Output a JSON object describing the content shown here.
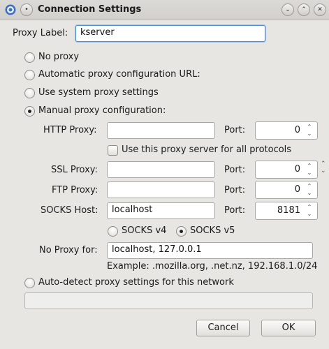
{
  "window": {
    "title": "Connection Settings"
  },
  "proxy_label": {
    "label": "Proxy Label:",
    "value": "kserver"
  },
  "options": {
    "no_proxy": "No proxy",
    "auto_url": "Automatic proxy configuration URL:",
    "system": "Use system proxy settings",
    "manual": "Manual proxy configuration:",
    "auto_detect": "Auto-detect proxy settings for this network"
  },
  "http": {
    "label": "HTTP Proxy:",
    "value": "",
    "port_label": "Port:",
    "port": "0"
  },
  "use_all": "Use this proxy server for all protocols",
  "ssl": {
    "label": "SSL Proxy:",
    "value": "",
    "port_label": "Port:",
    "port": "0"
  },
  "ftp": {
    "label": "FTP Proxy:",
    "value": "",
    "port_label": "Port:",
    "port": "0"
  },
  "socks": {
    "label": "SOCKS Host:",
    "value": "localhost",
    "port_label": "Port:",
    "port": "8181",
    "v4": "SOCKS v4",
    "v5": "SOCKS v5"
  },
  "no_proxy_for": {
    "label": "No Proxy for:",
    "value": "localhost, 127.0.0.1",
    "example": "Example: .mozilla.org, .net.nz, 192.168.1.0/24"
  },
  "buttons": {
    "cancel": "Cancel",
    "ok": "OK"
  },
  "colors": {
    "focus": "#4a90d9",
    "background": "#e8e6e3"
  }
}
